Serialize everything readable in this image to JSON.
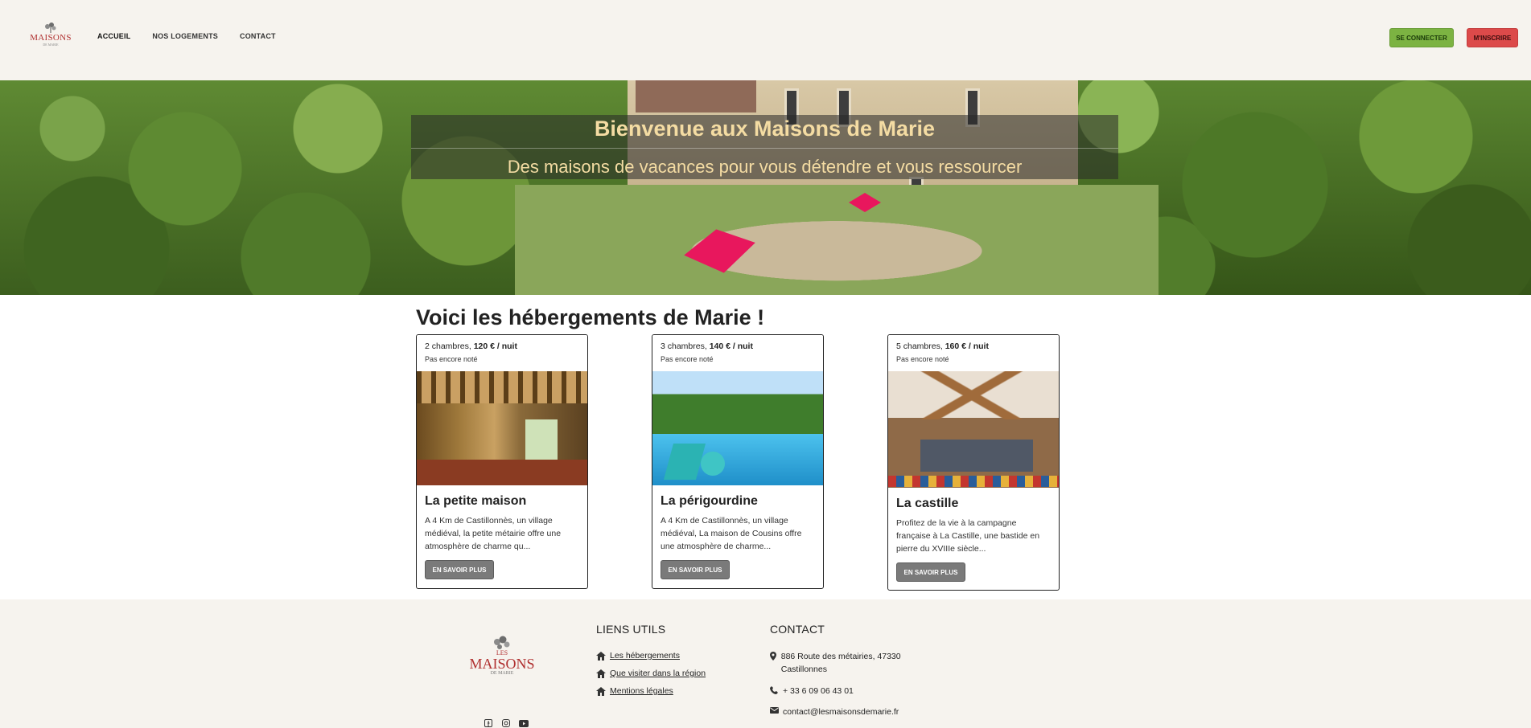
{
  "nav": {
    "logo_word": "MAISONS",
    "logo_sub": "DE MARIE",
    "links": [
      "ACCUEIL",
      "NOS LOGEMENTS",
      "CONTACT"
    ],
    "login_label": "SE CONNECTER",
    "signup_label": "M'INSCRIRE",
    "colors": {
      "login": "#7cb342",
      "signup": "#dc4a4a"
    }
  },
  "hero": {
    "title": "Bienvenue aux Maisons de Marie",
    "subtitle": "Des maisons de vacances pour vous détendre et vous ressourcer"
  },
  "main": {
    "section_title": "Voici les hébergements de Marie !",
    "more_label": "EN SAVOIR PLUS",
    "cards": [
      {
        "rooms_prefix": "2 chambres,",
        "price": "120 € / nuit",
        "rating": "Pas encore noté",
        "title": "La petite maison",
        "desc": "A 4 Km de Castillonnès, un village médiéval, la petite métairie offre une atmosphère de charme qu..."
      },
      {
        "rooms_prefix": "3 chambres,",
        "price": "140 € / nuit",
        "rating": "Pas encore noté",
        "title": "La périgourdine",
        "desc": "A 4 Km de Castillonnès, un village médiéval, La maison de Cousins offre une atmosphère de charme..."
      },
      {
        "rooms_prefix": "5 chambres,",
        "price": "160 € / nuit",
        "rating": "Pas encore noté",
        "title": "La castille",
        "desc": "Profitez de la vie à la campagne française à La Castille, une bastide en pierre du XVIIIe siècle..."
      }
    ]
  },
  "footer": {
    "logo_les": "LES",
    "logo_word": "MAISONS",
    "logo_sub": "DE MARIE",
    "links_title": "LIENS UTILS",
    "links": [
      " Les hébergements",
      "Que visiter dans la région",
      "Mentions légales"
    ],
    "contact_title": "CONTACT",
    "address": "886 Route des métairies, 47330 Castillonnes",
    "phone": "+ 33 6 09 06 43 01",
    "email": "contact@lesmaisonsdemarie.fr",
    "social_icons": [
      "facebook-icon",
      "instagram-icon",
      "youtube-icon"
    ]
  }
}
